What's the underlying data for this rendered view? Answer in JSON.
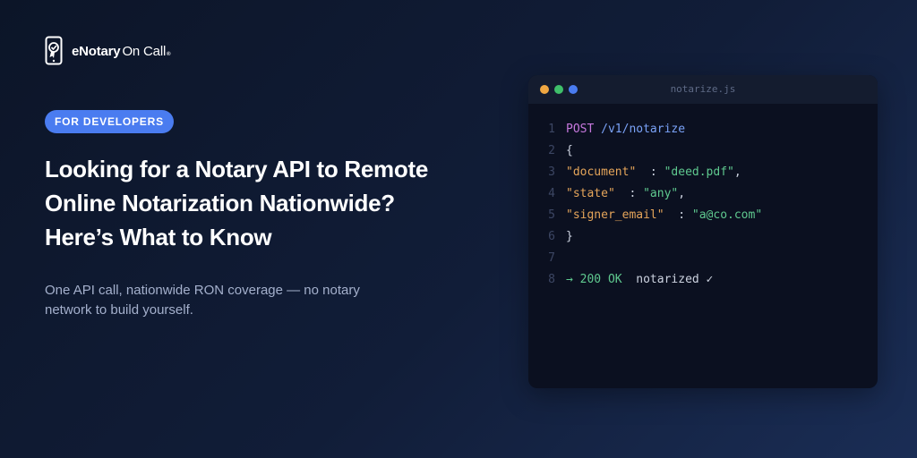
{
  "brand": {
    "name_bold": "eNotary",
    "name_light": "On Call",
    "trademark": "®",
    "icon": "phone-seal-icon"
  },
  "badge": "FOR DEVELOPERS",
  "headline": [
    "Looking for a Notary API to Remote",
    "Online Notarization Nationwide?",
    "Here’s What to Know"
  ],
  "subheadline": [
    "One API call, nationwide RON coverage — no notary",
    "network to build yourself."
  ],
  "editor": {
    "filename": "notarize.js",
    "dot_colors": [
      "#f0a742",
      "#3fbf6a",
      "#4a7cf0"
    ],
    "lines": [
      {
        "num": "1",
        "method": "POST",
        "path": " /v1/notarize"
      },
      {
        "num": "2",
        "text": "{"
      },
      {
        "num": "3",
        "key": "\"document\"",
        "sep": "  : ",
        "value": "\"deed.pdf\"",
        "end": ","
      },
      {
        "num": "4",
        "key": "\"state\"",
        "sep": "  : ",
        "value": "\"any\"",
        "end": ","
      },
      {
        "num": "5",
        "key": "\"signer_email\"",
        "sep": "  : ",
        "value": "\"a@co.com\"",
        "end": ""
      },
      {
        "num": "6",
        "text": "}"
      },
      {
        "num": "7",
        "text": ""
      },
      {
        "num": "8",
        "status": "→ 200 OK",
        "note": "  notarized ✓"
      }
    ]
  },
  "colors": {
    "accent": "#4a7cf0",
    "key": "#e5a55a",
    "string": "#5fc98f",
    "method": "#c678dd"
  }
}
